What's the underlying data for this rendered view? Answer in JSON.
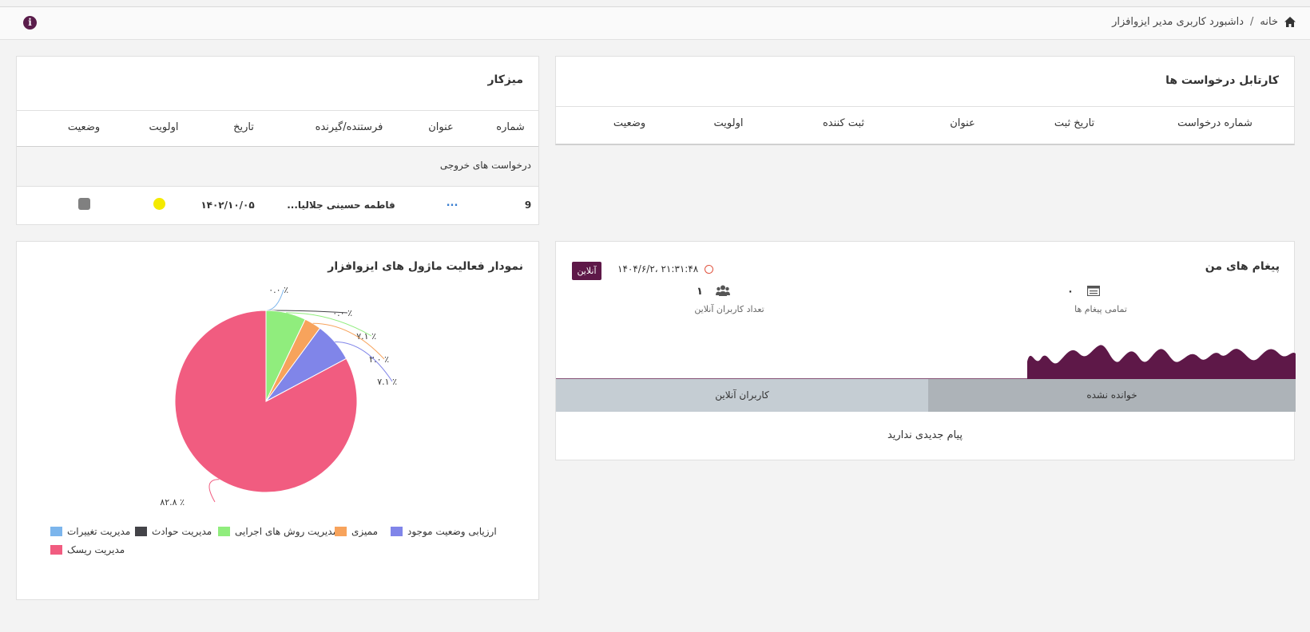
{
  "header": {
    "home_label": "خانه",
    "separator": "/",
    "page_title": "داشبورد کاربری مدیر ایزوافزار",
    "info_icon": "i"
  },
  "kartabl": {
    "title": "کارتابل درخواست ها",
    "columns": [
      "شماره درخواست",
      "تاریخ ثبت",
      "عنوان",
      "ثبت کننده",
      "اولویت",
      "وضعیت"
    ]
  },
  "mizkar": {
    "title": "میزکار",
    "columns": [
      "شماره",
      "عنوان",
      "فرستنده/گیرنده",
      "تاریخ",
      "اولویت",
      "وضعیت"
    ],
    "section_label": "درخواست های خروجی",
    "rows": [
      {
        "number": "9",
        "title": "...",
        "sender": "فاطمه حسینی جلالیا...",
        "date": "۱۴۰۲/۱۰/۰۵",
        "priority_color": "#f4ea00",
        "status_color": "#808080"
      }
    ]
  },
  "messages": {
    "title": "پیغام های من",
    "online_badge": "آنلاین",
    "datetime": "۱۴۰۴/۶/۲، ۲۱:۳۱:۴۸",
    "all_messages_value": "۰",
    "all_messages_label": "تمامی پیغام ها",
    "online_users_value": "۱",
    "online_users_label": "تعداد کاربران آنلاین",
    "tab_unread": "خوانده نشده",
    "tab_online_users": "کاربران آنلاین",
    "empty_text": "پیام جدیدی ندارید",
    "accent_color": "#5e1848"
  },
  "chart_panel": {
    "title": "نمودار فعالیت ماژول های ایزوافزار"
  },
  "chart_data": {
    "type": "pie",
    "title": "نمودار فعالیت ماژول های ایزوافزار",
    "slices": [
      {
        "name": "مدیریت تغییرات",
        "value": 0.0,
        "label": "٪ ۰.۰",
        "color": "#7cb5ec"
      },
      {
        "name": "مدیریت حوادث",
        "value": 0.0,
        "label": "٪ ۰.۰",
        "color": "#434348"
      },
      {
        "name": "مدیریت روش های اجرایی",
        "value": 7.1,
        "label": "٪ ۷.۱",
        "color": "#90ed7d"
      },
      {
        "name": "ممیزی",
        "value": 3.0,
        "label": "٪ ۳.۰",
        "color": "#f7a35c"
      },
      {
        "name": "ارزیابی وضعیت موجود",
        "value": 7.1,
        "label": "٪ ۷.۱",
        "color": "#8085e9"
      },
      {
        "name": "مدیریت ریسک",
        "value": 82.8,
        "label": "٪ ۸۲.۸",
        "color": "#f15c80"
      }
    ],
    "legend_position": "bottom"
  }
}
